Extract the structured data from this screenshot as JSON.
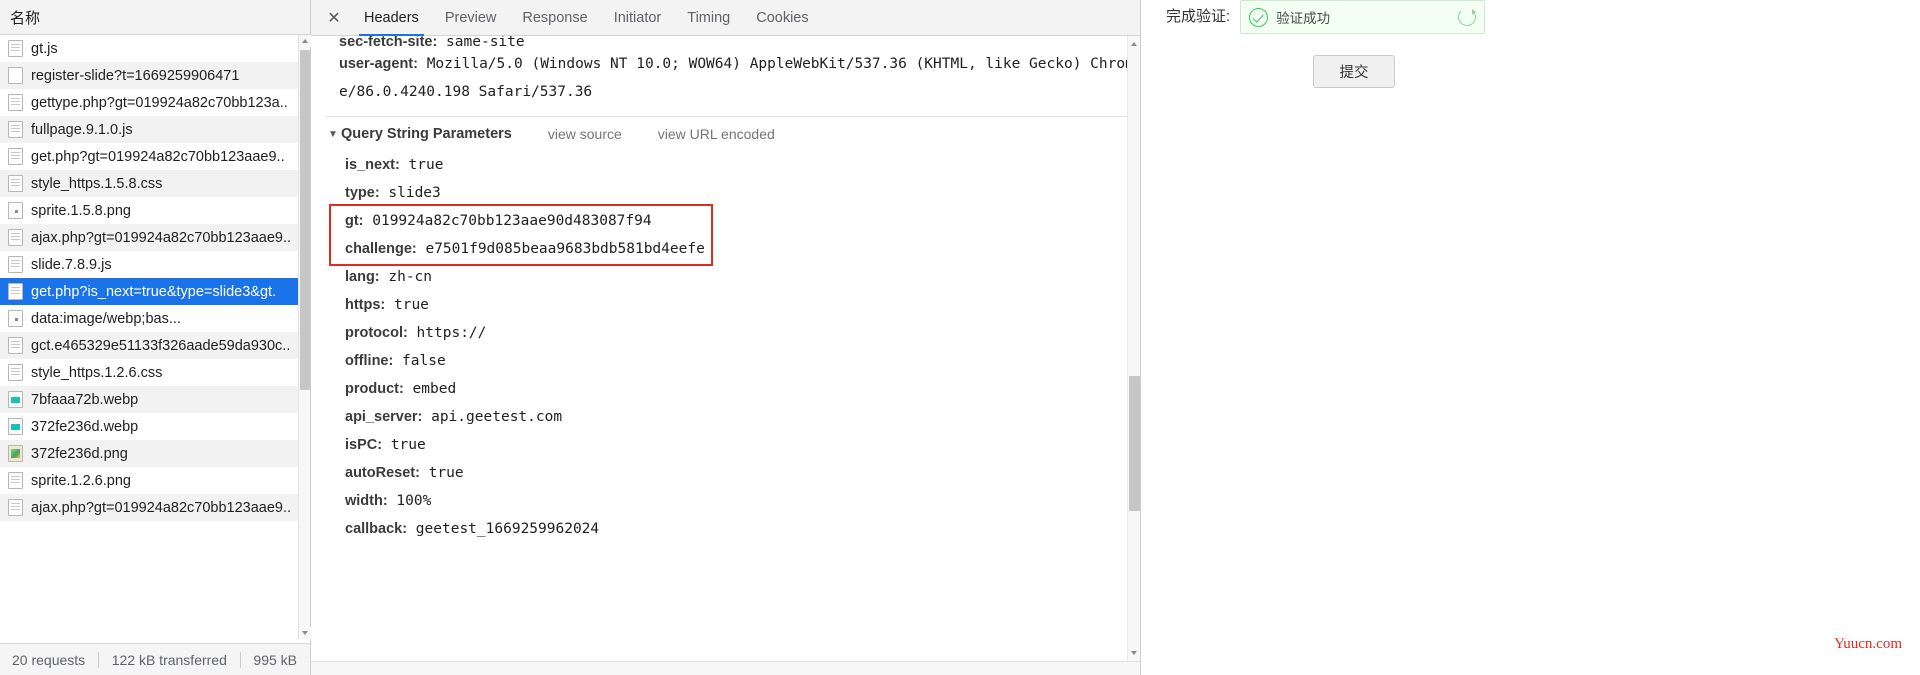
{
  "network_panel": {
    "column_header": "名称",
    "requests": [
      {
        "name": "gt.js",
        "icon": "document-icon"
      },
      {
        "name": "register-slide?t=1669259906471",
        "icon": "blank-document-icon"
      },
      {
        "name": "gettype.php?gt=019924a82c70bb123a..",
        "icon": "document-icon"
      },
      {
        "name": "fullpage.9.1.0.js",
        "icon": "document-icon"
      },
      {
        "name": "get.php?gt=019924a82c70bb123aae9..",
        "icon": "document-icon"
      },
      {
        "name": "style_https.1.5.8.css",
        "icon": "document-icon"
      },
      {
        "name": "sprite.1.5.8.png",
        "icon": "dot-document-icon"
      },
      {
        "name": "ajax.php?gt=019924a82c70bb123aae9..",
        "icon": "document-icon"
      },
      {
        "name": "slide.7.8.9.js",
        "icon": "document-icon"
      },
      {
        "name": "get.php?is_next=true&type=slide3&gt.",
        "icon": "document-icon",
        "selected": true
      },
      {
        "name": "data:image/webp;bas...",
        "icon": "dot-document-icon"
      },
      {
        "name": "gct.e465329e51133f326aade59da930c..",
        "icon": "document-icon"
      },
      {
        "name": "style_https.1.2.6.css",
        "icon": "document-icon"
      },
      {
        "name": "7bfaaa72b.webp",
        "icon": "webp-image-icon"
      },
      {
        "name": "372fe236d.webp",
        "icon": "webp-image-icon"
      },
      {
        "name": "372fe236d.png",
        "icon": "png-image-icon"
      },
      {
        "name": "sprite.1.2.6.png",
        "icon": "document-icon"
      },
      {
        "name": "ajax.php?gt=019924a82c70bb123aae9..",
        "icon": "document-icon"
      }
    ],
    "status_bar": {
      "requests": "20 requests",
      "transferred": "122 kB transferred",
      "resources": "995 kB"
    }
  },
  "detail_pane": {
    "close_icon": "✕",
    "tabs": [
      {
        "label": "Headers",
        "active": true
      },
      {
        "label": "Preview",
        "active": false
      },
      {
        "label": "Response",
        "active": false
      },
      {
        "label": "Initiator",
        "active": false
      },
      {
        "label": "Timing",
        "active": false
      },
      {
        "label": "Cookies",
        "active": false
      }
    ],
    "request_headers": [
      {
        "key": "sec-fetch-site:",
        "value": "same-site"
      },
      {
        "key": "user-agent:",
        "value": "Mozilla/5.0 (Windows NT 10.0; WOW64) AppleWebKit/537.36 (KHTML, like Gecko) Chrom"
      },
      {
        "key": "",
        "value": "e/86.0.4240.198 Safari/537.36"
      }
    ],
    "query_section": {
      "caret": "▼",
      "title": "Query String Parameters",
      "view_source": "view source",
      "view_url_encoded": "view URL encoded",
      "highlight_color": "#e02b20"
    },
    "query_params": [
      {
        "key": "is_next:",
        "value": "true"
      },
      {
        "key": "type:",
        "value": "slide3"
      },
      {
        "key": "gt:",
        "value": "019924a82c70bb123aae90d483087f94",
        "highlighted": true
      },
      {
        "key": "challenge:",
        "value": "e7501f9d085beaa9683bdb581bd4eefe",
        "highlighted": true
      },
      {
        "key": "lang:",
        "value": "zh-cn"
      },
      {
        "key": "https:",
        "value": "true"
      },
      {
        "key": "protocol:",
        "value": "https://"
      },
      {
        "key": "offline:",
        "value": "false"
      },
      {
        "key": "product:",
        "value": "embed"
      },
      {
        "key": "api_server:",
        "value": "api.geetest.com"
      },
      {
        "key": "isPC:",
        "value": "true"
      },
      {
        "key": "autoReset:",
        "value": "true"
      },
      {
        "key": "width:",
        "value": "100%"
      },
      {
        "key": "callback:",
        "value": "geetest_1669259962024"
      }
    ]
  },
  "page": {
    "verify_label": "完成验证:",
    "captcha_success_text": "验证成功",
    "check_icon": "check-circle-icon",
    "refresh_icon": "refresh-icon",
    "submit_label": "提交",
    "watermark": "Yuucn.com",
    "accent_green": "#3ac569",
    "accent_blue": "#1a73e8",
    "highlight_red": "#e02b20"
  }
}
